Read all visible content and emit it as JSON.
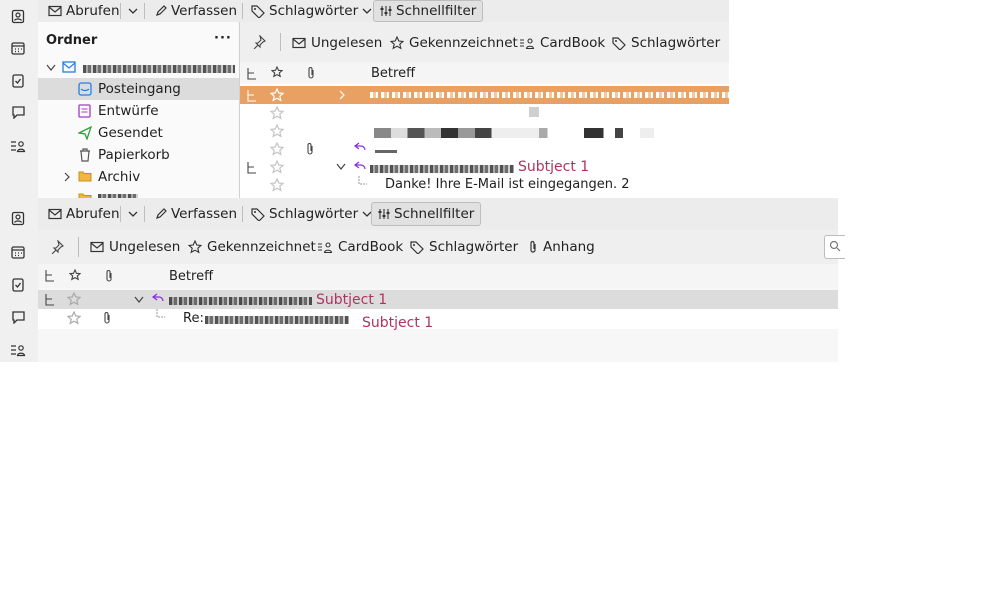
{
  "top": {
    "toolbar": {
      "get_messages": "Abrufen",
      "write": "Verfassen",
      "tags": "Schlagwörter",
      "quick_filter": "Schnellfilter"
    },
    "folder_pane": {
      "header": "Ordner",
      "menu": "···",
      "folders": [
        {
          "label": "Posteingang"
        },
        {
          "label": "Entwürfe"
        },
        {
          "label": "Gesendet"
        },
        {
          "label": "Papierkorb"
        },
        {
          "label": "Archiv"
        }
      ]
    },
    "quick_filter": {
      "unread": "Ungelesen",
      "starred": "Gekennzeichnet",
      "contact": "CardBook",
      "tags": "Schlagwörter"
    },
    "columns": {
      "subject": "Betreff"
    },
    "messages": {
      "row5_subject": "Subtject 1",
      "row6_subject": "Danke! Ihre E-Mail ist eingegangen. 2"
    }
  },
  "bottom": {
    "toolbar": {
      "get_messages": "Abrufen",
      "write": "Verfassen",
      "tags": "Schlagwörter",
      "quick_filter": "Schnellfilter"
    },
    "quick_filter": {
      "unread": "Ungelesen",
      "starred": "Gekennzeichnet",
      "contact": "CardBook",
      "tags": "Schlagwörter",
      "attachment": "Anhang"
    },
    "columns": {
      "subject": "Betreff"
    },
    "messages": {
      "row1_subject": "Subtject 1",
      "row2_prefix": "Re:",
      "row2_subject": "Subtject 1"
    }
  },
  "colors": {
    "selected_row": "#e8a063",
    "subject_pink": "#b0335f",
    "reply_arrow": "#8a2be2"
  }
}
